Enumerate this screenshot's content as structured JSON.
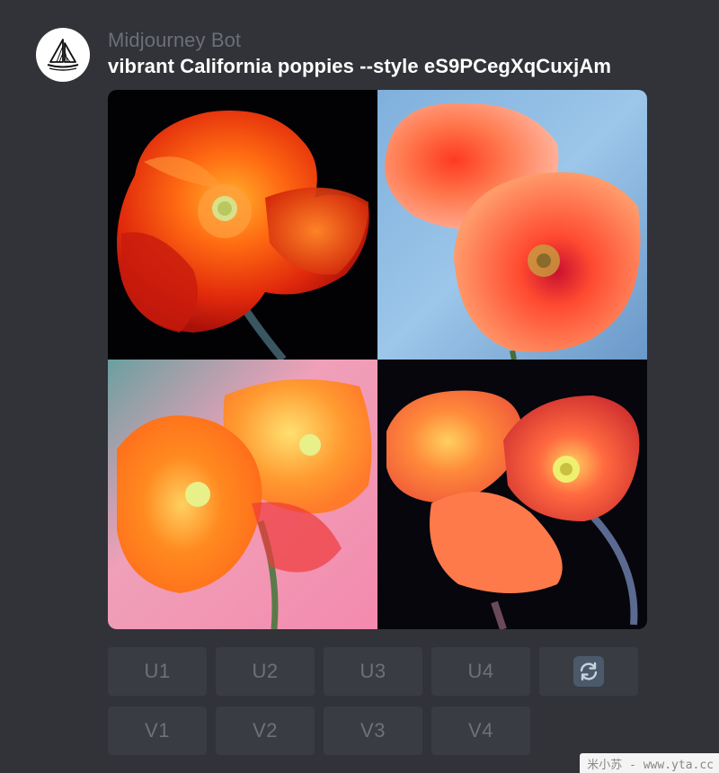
{
  "message": {
    "author": "Midjourney Bot",
    "prompt": "vibrant California poppies --style eS9PCegXqCuxjAm",
    "avatar_icon": "midjourney-boat-logo-icon"
  },
  "image_grid": {
    "tiles": [
      {
        "description": "orange poppy on black background"
      },
      {
        "description": "two coral poppies on light blue background"
      },
      {
        "description": "soft painterly orange poppies on pink background"
      },
      {
        "description": "two orange poppies on dark background"
      }
    ]
  },
  "actions": {
    "upscale": [
      "U1",
      "U2",
      "U3",
      "U4"
    ],
    "variation": [
      "V1",
      "V2",
      "V3",
      "V4"
    ],
    "reroll_icon": "refresh-icon"
  },
  "watermark": "米小苏 - www.yta.cc",
  "colors": {
    "background": "#313338",
    "button": "#393c42",
    "button_text": "#6e7178",
    "author_text": "#6d6f78",
    "prompt_text": "#ffffff"
  }
}
